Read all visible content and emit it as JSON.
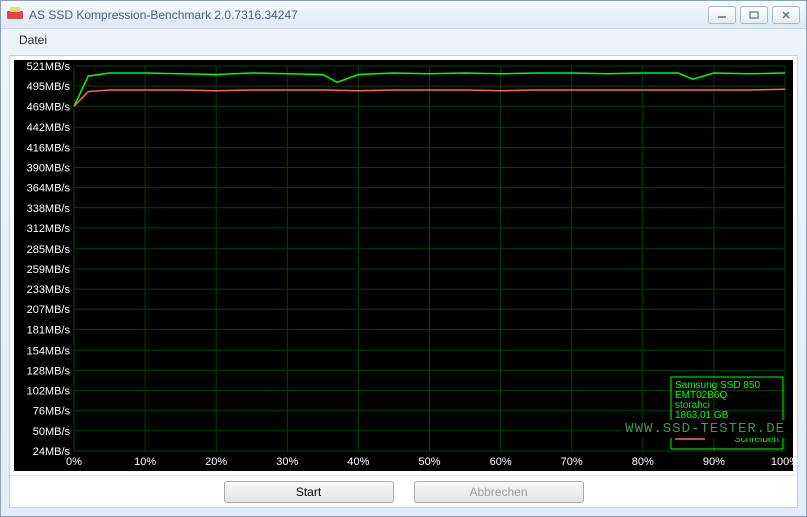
{
  "window": {
    "title": "AS SSD Kompression-Benchmark 2.0.7316.34247",
    "controls": {
      "min": "▁",
      "max": "▢",
      "close": "✕"
    }
  },
  "menu": {
    "file": "Datei"
  },
  "buttons": {
    "start": "Start",
    "abort": "Abbrechen"
  },
  "watermark": "WWW.SSD-TESTER.DE",
  "legend": {
    "device": "Samsung SSD 850",
    "firmware": "EMT02B6Q",
    "driver": "storahci",
    "capacity": "1863,01 GB",
    "read": "Lesen",
    "write": "Schreiben"
  },
  "chart_data": {
    "type": "line",
    "xlabel": "",
    "ylabel": "",
    "xlim": [
      0,
      100
    ],
    "ylim": [
      24,
      521
    ],
    "y_ticks": [
      521,
      495,
      469,
      442,
      416,
      390,
      364,
      338,
      312,
      285,
      259,
      233,
      207,
      181,
      154,
      128,
      102,
      76,
      50,
      24
    ],
    "y_tick_labels": [
      "521MB/s",
      "495MB/s",
      "469MB/s",
      "442MB/s",
      "416MB/s",
      "390MB/s",
      "364MB/s",
      "338MB/s",
      "312MB/s",
      "285MB/s",
      "259MB/s",
      "233MB/s",
      "207MB/s",
      "181MB/s",
      "154MB/s",
      "128MB/s",
      "102MB/s",
      "76MB/s",
      "50MB/s",
      "24MB/s"
    ],
    "x_ticks": [
      0,
      10,
      20,
      30,
      40,
      50,
      60,
      70,
      80,
      90,
      100
    ],
    "x_tick_labels": [
      "0%",
      "10%",
      "20%",
      "30%",
      "40%",
      "50%",
      "60%",
      "70%",
      "80%",
      "90%",
      "100%"
    ],
    "series": [
      {
        "name": "Lesen",
        "color": "#00ff00",
        "x": [
          0,
          2,
          5,
          10,
          15,
          20,
          25,
          30,
          35,
          37,
          40,
          45,
          50,
          55,
          60,
          65,
          70,
          75,
          80,
          85,
          87,
          90,
          95,
          100
        ],
        "y": [
          469,
          508,
          512,
          512,
          511,
          510,
          512,
          511,
          510,
          500,
          510,
          512,
          511,
          512,
          511,
          512,
          512,
          511,
          512,
          512,
          504,
          512,
          511,
          512
        ]
      },
      {
        "name": "Schreiben",
        "color": "#ff6666",
        "x": [
          0,
          2,
          5,
          10,
          15,
          20,
          25,
          30,
          35,
          40,
          45,
          50,
          55,
          60,
          65,
          70,
          75,
          80,
          85,
          90,
          95,
          100
        ],
        "y": [
          469,
          488,
          490,
          490,
          490,
          489,
          490,
          490,
          490,
          489,
          490,
          490,
          490,
          489,
          490,
          490,
          490,
          490,
          490,
          490,
          490,
          491
        ]
      }
    ]
  }
}
